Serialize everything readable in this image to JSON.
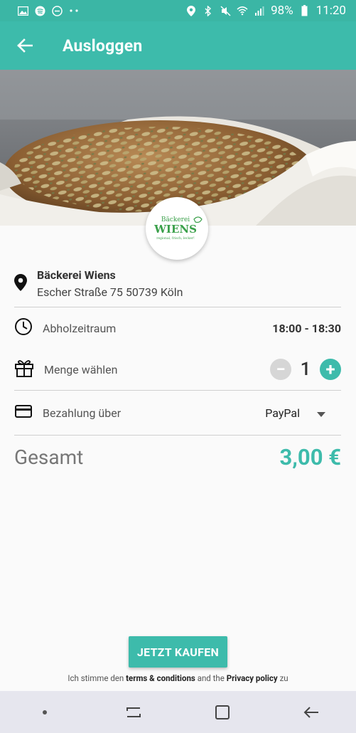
{
  "status_bar": {
    "battery": "98%",
    "time": "11:20",
    "icons_left": [
      "gallery-icon",
      "spotify-icon",
      "dnd-icon",
      "more-dots-icon"
    ],
    "icons_right": [
      "location-icon",
      "bluetooth-icon",
      "mute-icon",
      "wifi-icon",
      "signal-icon",
      "battery-icon"
    ]
  },
  "app_bar": {
    "title": "Ausloggen",
    "back_icon": "arrow-left-icon"
  },
  "shop": {
    "logo_text_top": "Bäckerei",
    "logo_text_main": "WIENS",
    "logo_text_sub": "regional, frisch, lecker!",
    "name": "Bäckerei Wiens",
    "address": "Escher Straße 75 50739 Köln"
  },
  "pickup": {
    "label": "Abholzeitraum",
    "value": "18:00 - 18:30"
  },
  "quantity": {
    "label": "Menge wählen",
    "value": "1",
    "minus": "−",
    "plus": "+"
  },
  "payment": {
    "label": "Bezahlung über",
    "selected": "PayPal"
  },
  "total": {
    "label": "Gesamt",
    "value": "3,00 €"
  },
  "cta": {
    "label": "JETZT KAUFEN"
  },
  "terms": {
    "prefix": "Ich stimme den",
    "terms_link": "terms & conditions",
    "middle": "and the",
    "privacy_link": "Privacy policy",
    "suffix": "zu"
  },
  "colors": {
    "accent": "#3dbbab",
    "status_bar": "#3bb6a5"
  }
}
